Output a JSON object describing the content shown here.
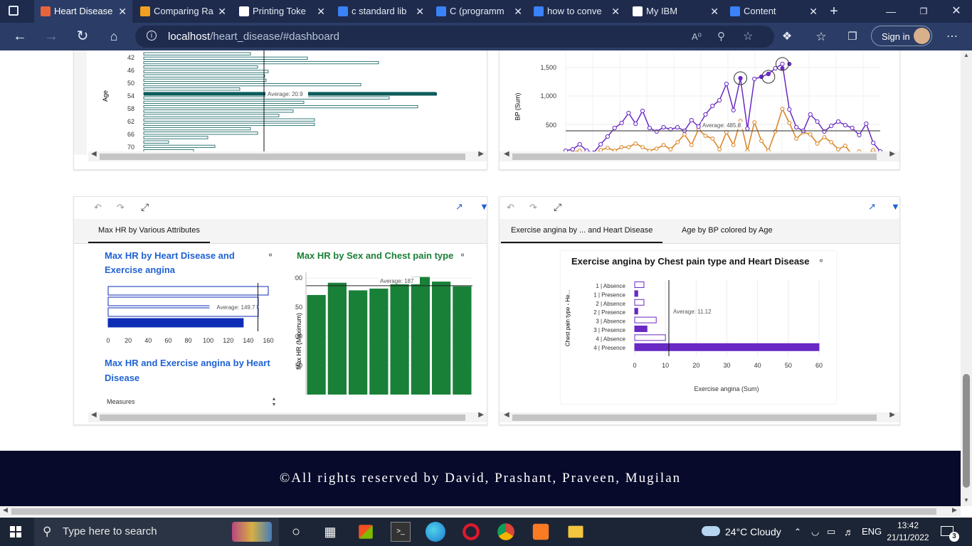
{
  "browser": {
    "tabs": [
      {
        "label": "Heart Disease",
        "color": "#e8643c"
      },
      {
        "label": "Comparing Ra",
        "color": "#f0a020"
      },
      {
        "label": "Printing Toke",
        "color": "#ffffff"
      },
      {
        "label": "c standard lib",
        "color": "#3a82f7"
      },
      {
        "label": "C (programm",
        "color": "#3a82f7"
      },
      {
        "label": "how to conve",
        "color": "#3a82f7"
      },
      {
        "label": "My IBM",
        "color": "#ffffff"
      },
      {
        "label": "Content",
        "color": "#3a82f7"
      }
    ],
    "url_host": "localhost",
    "url_path": "/heart_disease/#dashboard",
    "sign_in": "Sign in"
  },
  "panel_top_left": {
    "ylabel": "Age",
    "age_ticks": [
      "42",
      "46",
      "50",
      "54",
      "58",
      "62",
      "66",
      "70"
    ],
    "average_label": "Average: 20.9"
  },
  "panel_top_right": {
    "ylabel": "BP (Sum)",
    "y_ticks": [
      "1,500",
      "1,000",
      "500"
    ],
    "average_label": "Average: 485.8"
  },
  "panel_bottom_left": {
    "tab_label": "Max HR by Various Attributes",
    "chart1_title_line1": "Max HR by Heart Disease and",
    "chart1_title_line2": "Exercise angina",
    "chart1_average": "Average: 149.7",
    "chart1_x_ticks": [
      "0",
      "20",
      "40",
      "60",
      "80",
      "100",
      "120",
      "140",
      "160"
    ],
    "chart2_title": "Max HR by Sex and Chest pain type",
    "chart2_ylabel": "Max HR (Maximum)",
    "chart2_average": "Average: 187",
    "chart2_y_ticks": [
      "200",
      "150",
      "100",
      "50"
    ],
    "chart3_title_line1": "Max HR and Exercise angina by Heart",
    "chart3_title_line2": "Disease",
    "measures_label": "Measures"
  },
  "panel_bottom_right": {
    "tab1_label": "Exercise angina by ... and Heart Disease",
    "tab2_label": "Age by BP colored by Age",
    "chart_title": "Exercise angina by Chest pain type and Heart Disease",
    "ylabel": "Chest pain type - He...",
    "xlabel": "Exercise angina (Sum)",
    "categories": [
      "1 | Absence",
      "1 | Presence",
      "2 | Absence",
      "2 | Presence",
      "3 | Absence",
      "3 | Presence",
      "4 | Absence",
      "4 | Presence"
    ],
    "x_ticks": [
      "0",
      "10",
      "20",
      "30",
      "40",
      "50",
      "60"
    ],
    "average_label": "Average: 11.12"
  },
  "footer": {
    "text": "©All rights reserved by David, Prashant, Praveen, Mugilan"
  },
  "taskbar": {
    "search_placeholder": "Type here to search",
    "weather": "24°C  Cloudy",
    "lang": "ENG",
    "time": "13:42",
    "date": "21/11/2022",
    "notif_count": "3"
  },
  "chart_data": [
    {
      "type": "bar",
      "title": "",
      "ylabel": "Age",
      "categories": [
        "42",
        "46",
        "50",
        "54",
        "58",
        "62",
        "66",
        "70"
      ],
      "average": 20.9
    },
    {
      "type": "bar",
      "title": "Max HR by Heart Disease and Exercise angina",
      "values": [
        160,
        150,
        150,
        135
      ],
      "average": 149.7,
      "xlim": [
        0,
        160
      ]
    },
    {
      "type": "bar",
      "title": "Max HR by Sex and Chest pain type",
      "ylabel": "Max HR (Maximum)",
      "values": [
        171,
        192,
        179,
        182,
        190,
        202,
        194,
        186
      ],
      "average": 187,
      "ylim": [
        0,
        210
      ]
    },
    {
      "type": "bar",
      "title": "Exercise angina by Chest pain type and Heart Disease",
      "xlabel": "Exercise angina (Sum)",
      "ylabel": "Chest pain type - He...",
      "categories": [
        "1 | Absence",
        "1 | Presence",
        "2 | Absence",
        "2 | Presence",
        "3 | Absence",
        "3 | Presence",
        "4 | Absence",
        "4 | Presence"
      ],
      "values": [
        3,
        1,
        3,
        1,
        7,
        4,
        10,
        60
      ],
      "average": 11.12,
      "xlim": [
        0,
        60
      ]
    }
  ]
}
